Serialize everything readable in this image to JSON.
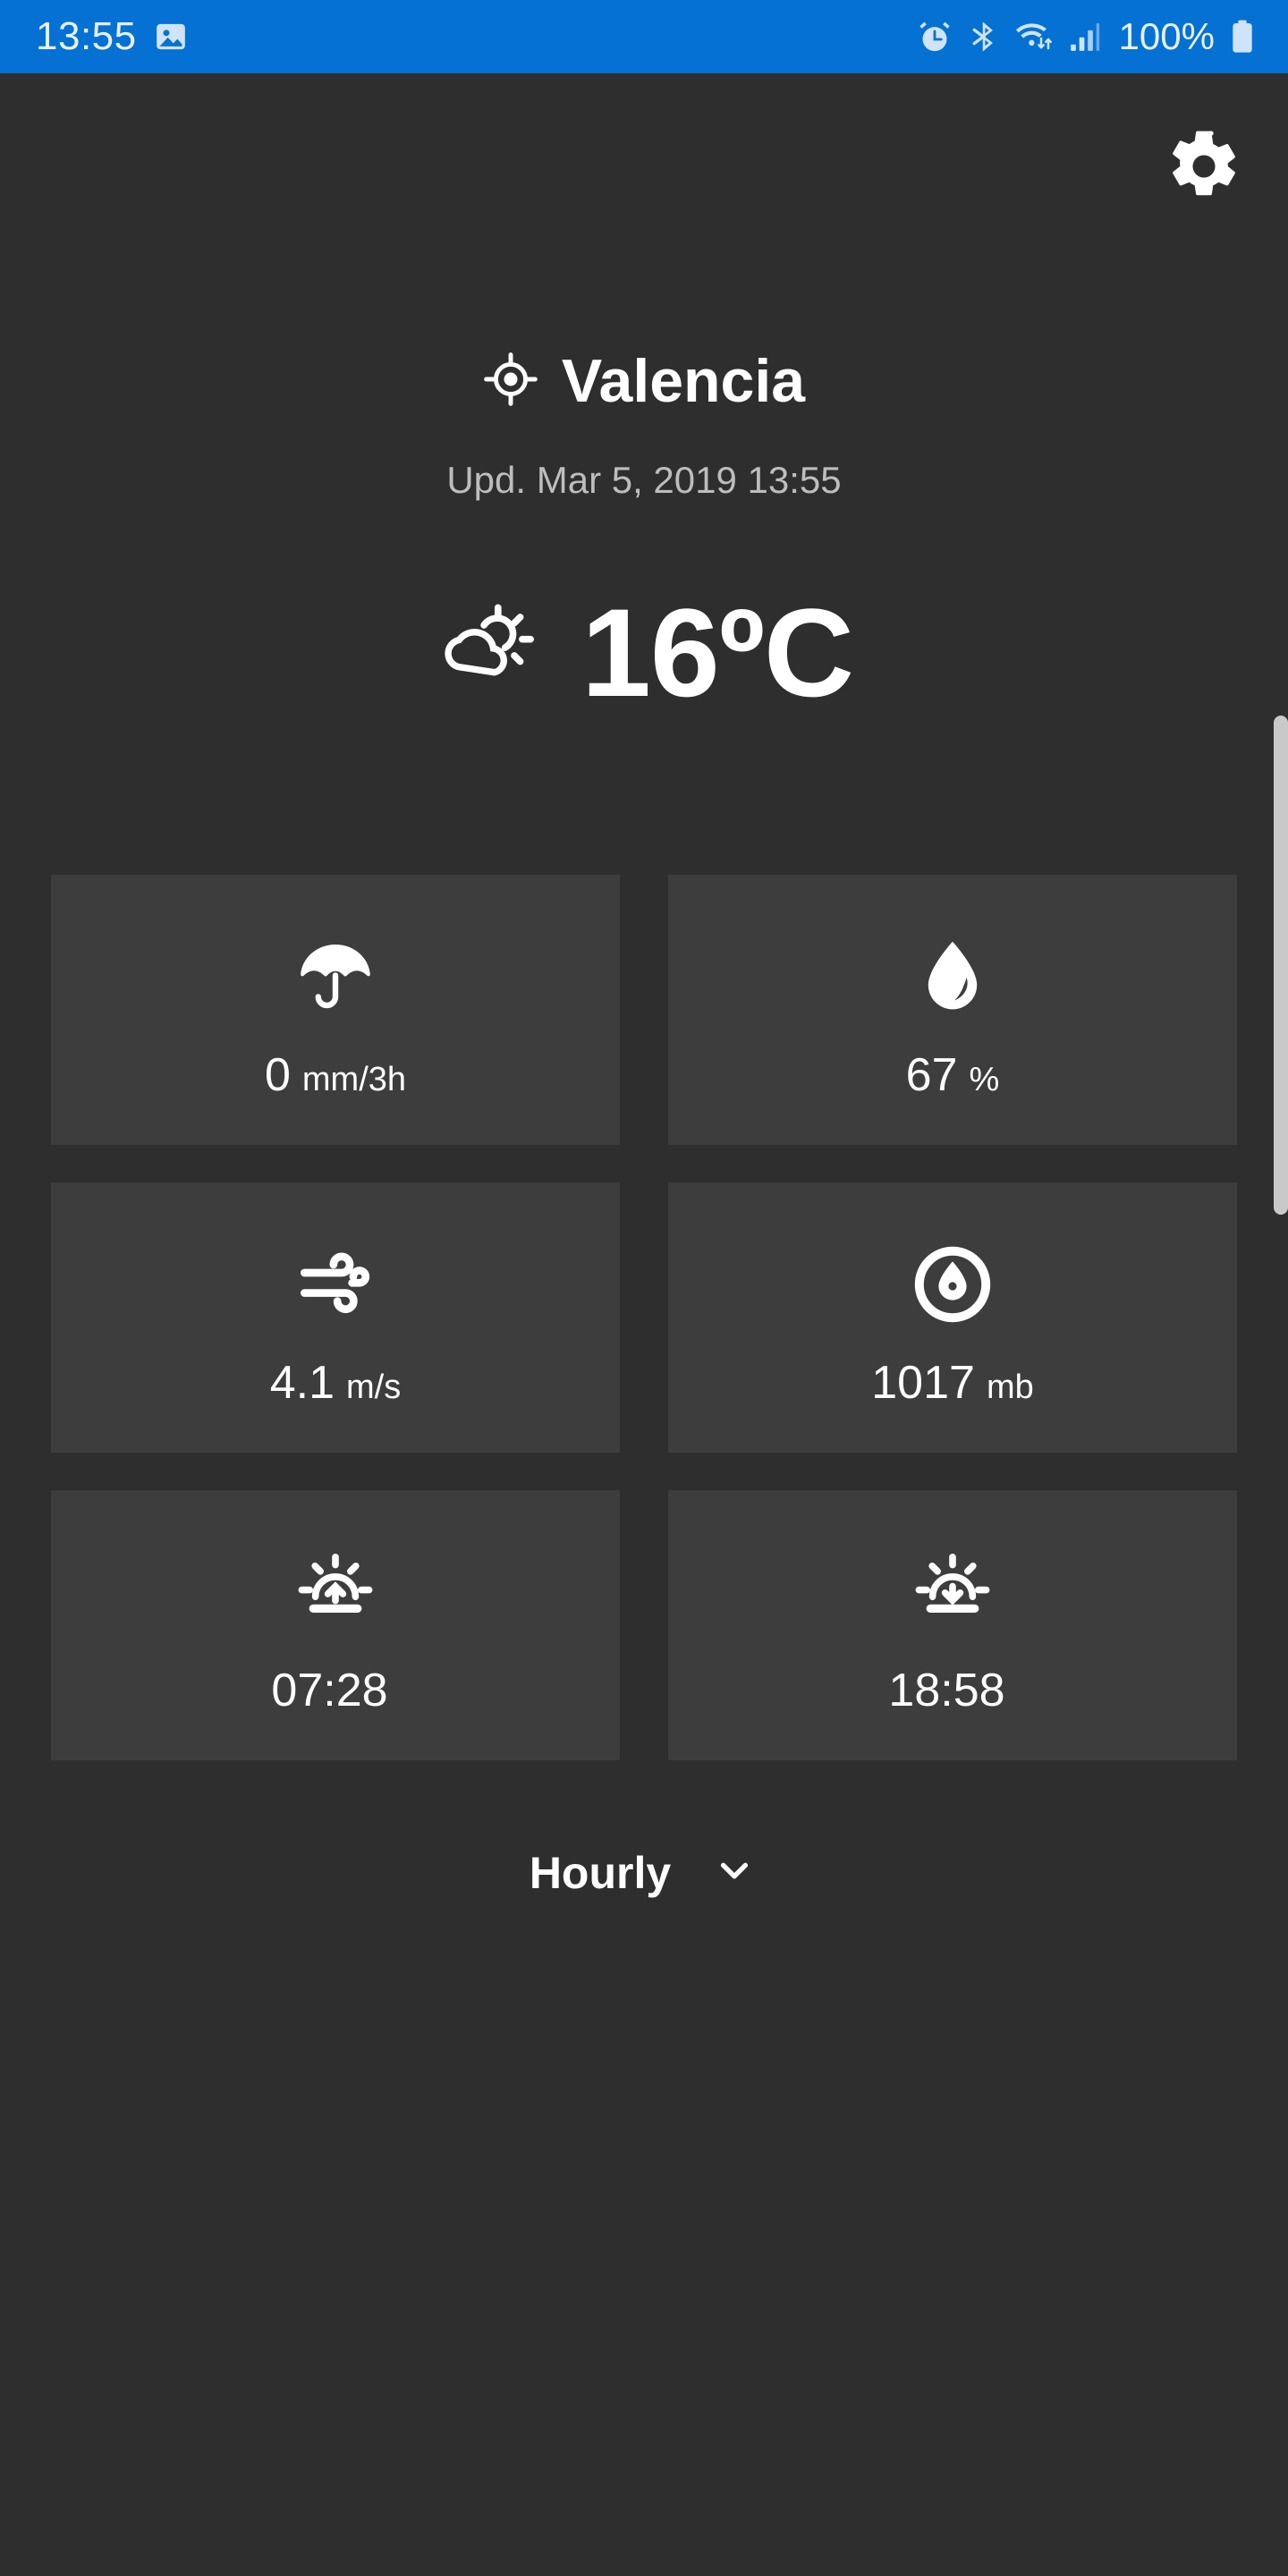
{
  "status_bar": {
    "background_color": "#0571d3",
    "time": "13:55",
    "battery_percent": "100%",
    "icons_left": [
      "photo-icon"
    ],
    "icons_right": [
      "alarm-icon",
      "bluetooth-icon",
      "wifi-icon",
      "signal-icon",
      "battery-icon"
    ]
  },
  "app": {
    "background_color": "#2e2e2e",
    "tile_color": "#3d3d3d",
    "settings_label": "gear-icon"
  },
  "header": {
    "location_icon": "gps-location-icon",
    "city": "Valencia",
    "updated": "Upd. Mar 5, 2019 13:55"
  },
  "current": {
    "condition_icon": "partly-cloudy-day-icon",
    "temperature": "16ºC"
  },
  "tiles": [
    {
      "name": "precipitation",
      "icon": "umbrella-icon",
      "value": "0",
      "unit": "mm/3h"
    },
    {
      "name": "humidity",
      "icon": "water-drop-icon",
      "value": "67",
      "unit": "%"
    },
    {
      "name": "wind",
      "icon": "wind-icon",
      "value": "4.1",
      "unit": "m/s"
    },
    {
      "name": "pressure",
      "icon": "barometer-icon",
      "value": "1017",
      "unit": "mb"
    },
    {
      "name": "sunrise",
      "icon": "sunrise-icon",
      "value": "07:28",
      "unit": ""
    },
    {
      "name": "sunset",
      "icon": "sunset-icon",
      "value": "18:58",
      "unit": ""
    }
  ],
  "forecast_toggle": {
    "label": "Hourly",
    "chevron": "chevron-down-icon"
  }
}
